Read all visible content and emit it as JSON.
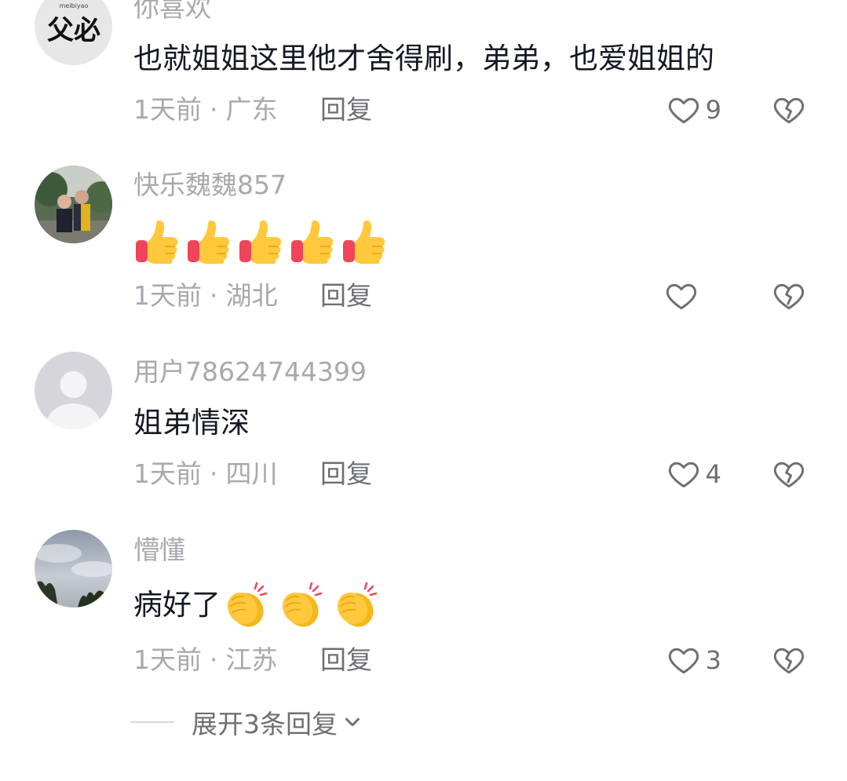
{
  "comments": [
    {
      "username": "你喜欢",
      "text": "也就姐姐这里他才舍得刷，弟弟，也爱姐姐的",
      "emoji": [],
      "time": "1天前",
      "separator": "·",
      "location": "广东",
      "reply_label": "回复",
      "likes": "9",
      "avatar_text": "meibiyao",
      "avatar_glyphs": "父必"
    },
    {
      "username": "快乐魏魏857",
      "text": "",
      "emoji": [
        "thumbs-up",
        "thumbs-up",
        "thumbs-up",
        "thumbs-up",
        "thumbs-up"
      ],
      "time": "1天前",
      "separator": "·",
      "location": "湖北",
      "reply_label": "回复",
      "likes": ""
    },
    {
      "username": "用户78624744399",
      "text": "姐弟情深",
      "emoji": [],
      "time": "1天前",
      "separator": "·",
      "location": "四川",
      "reply_label": "回复",
      "likes": "4"
    },
    {
      "username": "懵懂",
      "text": "病好了",
      "emoji": [
        "clapping-hands",
        "clapping-hands",
        "clapping-hands"
      ],
      "time": "1天前",
      "separator": "·",
      "location": "江苏",
      "reply_label": "回复",
      "likes": "3"
    }
  ],
  "expand_replies": {
    "label": "展开3条回复"
  },
  "colors": {
    "text_primary": "#161823",
    "text_secondary": "#a8a8ae",
    "action": "#6e6f75",
    "thumb_yellow": "#ffc83d",
    "thumb_red": "#f0445a"
  }
}
